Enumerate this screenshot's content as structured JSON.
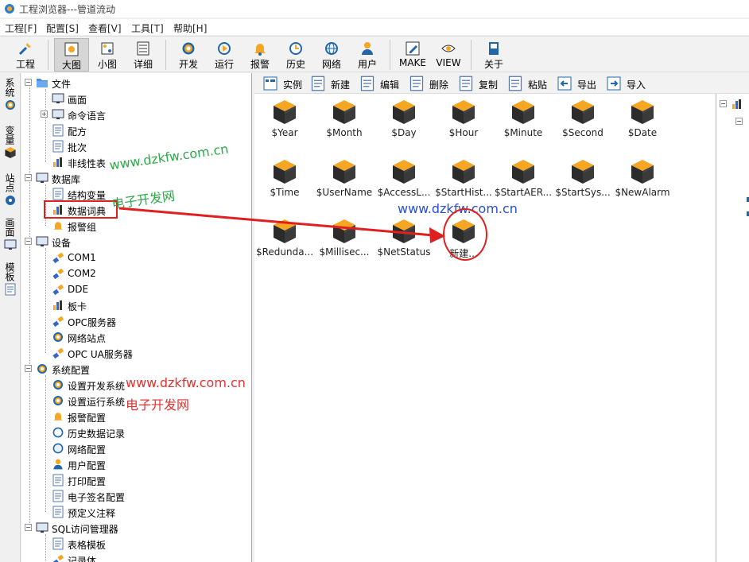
{
  "window": {
    "title": "工程浏览器---管道流动"
  },
  "menu": [
    "工程[F]",
    "配置[S]",
    "查看[V]",
    "工具[T]",
    "帮助[H]"
  ],
  "toolbar": {
    "project": "工程",
    "large": "大图",
    "small": "小图",
    "detail": "详细",
    "develop": "开发",
    "run": "运行",
    "alarm": "报警",
    "history": "历史",
    "network": "网络",
    "user": "用户",
    "make": "MAKE",
    "view": "VIEW",
    "about": "关于"
  },
  "vtabs": [
    "系统",
    "变量",
    "站点",
    "画面",
    "模板"
  ],
  "tree": {
    "file": "文件",
    "screen": "画面",
    "cmd": "命令语言",
    "recipe": "配方",
    "batch": "批次",
    "nonlinear": "非线性表",
    "database": "数据库",
    "struct_var": "结构变量",
    "data_dict": "数据词典",
    "alarm_group": "报警组",
    "device": "设备",
    "com1": "COM1",
    "com2": "COM2",
    "dde": "DDE",
    "board": "板卡",
    "opc": "OPC服务器",
    "netsite": "网络站点",
    "opcua": "OPC UA服务器",
    "sysconfig": "系统配置",
    "set_dev": "设置开发系统",
    "set_run": "设置运行系统",
    "alarm_cfg": "报警配置",
    "hist_rec": "历史数据记录",
    "net_cfg": "网络配置",
    "user_cfg": "用户配置",
    "print_cfg": "打印配置",
    "esign_cfg": "电子签名配置",
    "predef": "预定义注释",
    "sql": "SQL访问管理器",
    "table_tpl": "表格模板",
    "record": "记录体"
  },
  "right_toolbar": {
    "instance": "实例",
    "new": "新建",
    "edit": "编辑",
    "delete": "删除",
    "copy": "复制",
    "paste": "粘贴",
    "export": "导出",
    "import": "导入"
  },
  "items": [
    "$Year",
    "$Month",
    "$Day",
    "$Hour",
    "$Minute",
    "$Second",
    "$Date",
    "$Time",
    "$UserName",
    "$AccessL...",
    "$StartHist...",
    "$StartAER...",
    "$StartSys...",
    "$NewAlarm",
    "$Redunda...",
    "$Millisec...",
    "$NetStatus",
    "新建..."
  ],
  "watermarks": {
    "url": "www.dzkfw.com.cn",
    "name": "电子开发网"
  },
  "colors": {
    "accent": "#f5a623",
    "cube_dark": "#2b2b2b",
    "mark": "#e02020"
  }
}
